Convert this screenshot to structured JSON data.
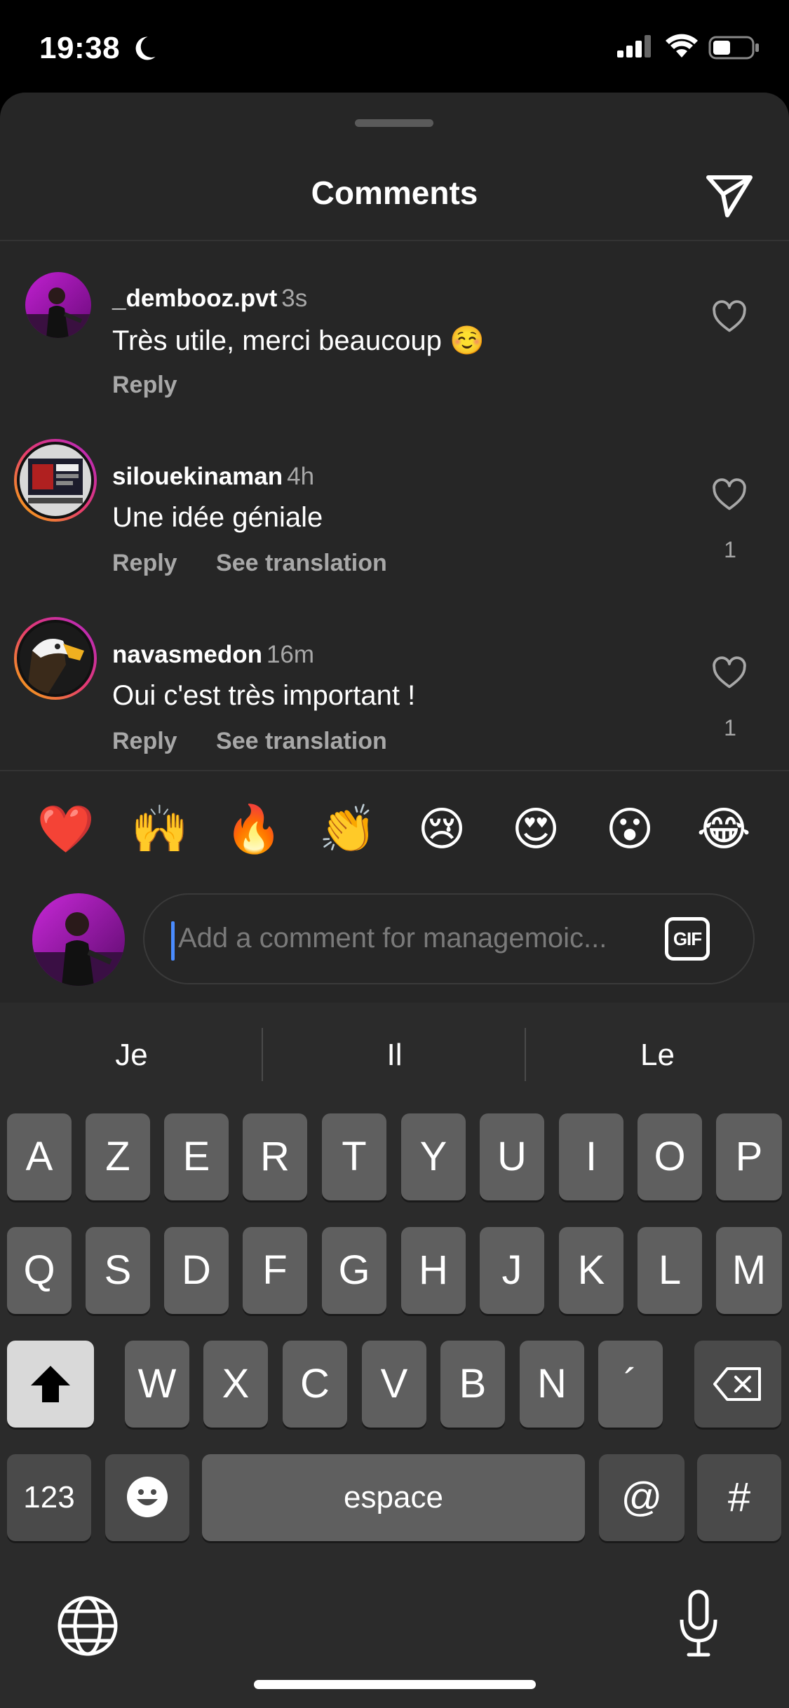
{
  "status_bar": {
    "time": "19:38"
  },
  "sheet": {
    "title": "Comments"
  },
  "comments": [
    {
      "username": "_dembooz.pvt",
      "time_ago": "3s",
      "text": "Très utile, merci beaucoup ☺️",
      "reply": "Reply",
      "see_translation": "",
      "likes": ""
    },
    {
      "username": "silouekinaman",
      "time_ago": "4h",
      "text": "Une idée géniale",
      "reply": "Reply",
      "see_translation": "See translation",
      "likes": "1"
    },
    {
      "username": "navasmedon",
      "time_ago": "16m",
      "text": "Oui c'est très important !",
      "reply": "Reply",
      "see_translation": "See translation",
      "likes": "1"
    }
  ],
  "reactions": [
    "❤️",
    "🙌",
    "🔥",
    "👏",
    "😢",
    "😍",
    "😮",
    "😂"
  ],
  "composer": {
    "placeholder": "Add a comment for managemoic...",
    "gif_label": "GIF"
  },
  "keyboard": {
    "suggestions": [
      "Je",
      "Il",
      "Le"
    ],
    "row1": [
      "A",
      "Z",
      "E",
      "R",
      "T",
      "Y",
      "U",
      "I",
      "O",
      "P"
    ],
    "row2": [
      "Q",
      "S",
      "D",
      "F",
      "G",
      "H",
      "J",
      "K",
      "L",
      "M"
    ],
    "row3": [
      "W",
      "X",
      "C",
      "V",
      "B",
      "N",
      "´"
    ],
    "numbers_label": "123",
    "space_label": "espace",
    "at_label": "@",
    "hash_label": "#"
  },
  "icons": {
    "send": "paper-plane-icon",
    "heart": "heart-outline-icon",
    "shift": "shift-arrow-icon",
    "backspace": "backspace-icon",
    "emoji": "emoji-face-icon",
    "globe": "globe-icon",
    "mic": "microphone-icon"
  },
  "colors": {
    "background": "#262626",
    "caret": "#4a8cff",
    "muted": "#a8a8a8"
  }
}
